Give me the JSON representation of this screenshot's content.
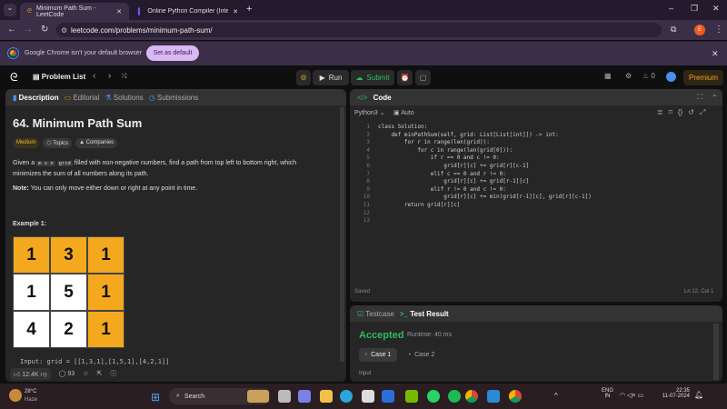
{
  "browser": {
    "tabs": [
      {
        "title": "Minimum Path Sum - LeetCode",
        "active": true
      },
      {
        "title": "Online Python Compiler (Interp",
        "active": false
      }
    ],
    "url": "leetcode.com/problems/minimum-path-sum/",
    "infobar": {
      "message": "Google Chrome isn't your default browser",
      "button": "Set as default"
    },
    "profile_initial": "E"
  },
  "nav": {
    "problem_list": "Problem List",
    "run": "Run",
    "submit": "Submit",
    "streak": "0",
    "premium": "Premium"
  },
  "description": {
    "tabs": [
      "Description",
      "Editorial",
      "Solutions",
      "Submissions"
    ],
    "title": "64. Minimum Path Sum",
    "difficulty": "Medium",
    "topics": "Topics",
    "companies": "Companies",
    "text1": "Given a",
    "code1": "m x n",
    "code2": "grid",
    "text2": "filled with non-negative numbers, find a path from top left to bottom right, which minimizes the sum of all numbers along its path.",
    "note_label": "Note:",
    "note": "You can only move either down or right at any point in time.",
    "example": "Example 1:",
    "grid": [
      [
        1,
        3,
        1
      ],
      [
        1,
        5,
        1
      ],
      [
        4,
        2,
        1
      ]
    ],
    "path_color": "#f4a81d",
    "input_line": "Input: grid = [[1,3,1],[1,5,1],[4,2,1]]",
    "likes": "12.4K",
    "comments": "93"
  },
  "code": {
    "header": "Code",
    "language": "Python3",
    "autocomplete": "Auto",
    "lines": [
      "class Solution:",
      "    def minPathSum(self, grid: List[List[int]]) -> int:",
      "        for r in range(len(grid)):",
      "            for c in range(len(grid[0])):",
      "                if r == 0 and c != 0:",
      "                    grid[r][c] += grid[r][c-1]",
      "                elif c == 0 and r != 0:",
      "                    grid[r][c] += grid[r-1][c]",
      "                elif r != 0 and c != 0:",
      "                    grid[r][c] += min(grid[r-1][c], grid[r][c-1])",
      "        return grid[r][c]",
      "",
      ""
    ],
    "status": "Saved",
    "cursor": "Ln 12, Col 1"
  },
  "result": {
    "tab1": "Testcase",
    "tab2": "Test Result",
    "verdict": "Accepted",
    "runtime": "Runtime: 40 ms",
    "cases": [
      "Case 1",
      "Case 2"
    ],
    "input_label": "Input"
  },
  "taskbar": {
    "temp": "28°C",
    "weather": "Haze",
    "search": "Search",
    "lang": "ENG",
    "region": "IN",
    "time": "22:35",
    "date": "11-07-2024"
  }
}
